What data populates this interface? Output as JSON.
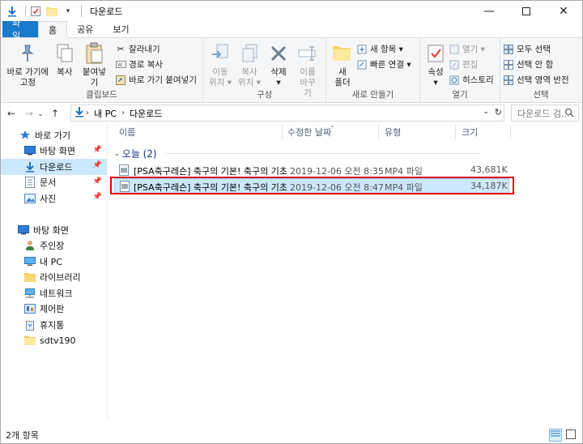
{
  "window": {
    "title": "다운로드",
    "min_icon": "minimize-icon",
    "max_icon": "maximize-icon",
    "close_icon": "close-icon"
  },
  "quick_access": {
    "down_arrow": "down-arrow-icon",
    "properties": "properties-icon",
    "new_folder": "folder-icon",
    "customize": "▾"
  },
  "tabs": [
    {
      "label": "파일"
    },
    {
      "label": "홈"
    },
    {
      "label": "공유"
    },
    {
      "label": "보기"
    }
  ],
  "ribbon": {
    "clipboard": {
      "label": "클립보드",
      "pin": "바로 가기에\n고정",
      "copy": "복사",
      "paste": "붙여넣기",
      "cut": "잘라내기",
      "copy_path": "경로 복사",
      "paste_shortcut": "바로 가기 붙여넣기"
    },
    "organize": {
      "label": "구성",
      "move": "이동\n위치 ▾",
      "copyto": "복사\n위치 ▾",
      "delete": "삭제\n▾",
      "rename": "이름\n바꾸기"
    },
    "new": {
      "label": "새로 만들기",
      "new_folder": "새\n폴더",
      "new_item": "새 항목 ▾",
      "easy_access": "빠른 연결 ▾"
    },
    "open": {
      "label": "열기",
      "properties": "속성\n▾",
      "open": "열기 ▾",
      "edit": "편집",
      "history": "히스토리"
    },
    "select": {
      "label": "선택",
      "select_all": "모두 선택",
      "select_none": "선택 안 함",
      "invert": "선택 영역 반전"
    }
  },
  "address": {
    "crumbs": [
      "내 PC",
      "다운로드"
    ],
    "search_placeholder": "다운로드 검..."
  },
  "navpane": {
    "items": [
      {
        "label": "바로 가기",
        "icon": "star-icon"
      },
      {
        "label": "바탕 화면",
        "icon": "desktop-icon",
        "pinned": true
      },
      {
        "label": "다운로드",
        "icon": "download-icon",
        "pinned": true,
        "selected": true
      },
      {
        "label": "문서",
        "icon": "document-icon",
        "pinned": true
      },
      {
        "label": "사진",
        "icon": "pictures-icon",
        "pinned": true
      },
      {
        "label": "",
        "icon": ""
      },
      {
        "label": "바탕 화면",
        "icon": "desktop-icon"
      },
      {
        "label": "주인장",
        "icon": "user-icon"
      },
      {
        "label": "내 PC",
        "icon": "computer-icon"
      },
      {
        "label": "라이브러리",
        "icon": "library-icon"
      },
      {
        "label": "네트워크",
        "icon": "network-icon"
      },
      {
        "label": "제어판",
        "icon": "control-panel-icon"
      },
      {
        "label": "휴지통",
        "icon": "recycle-bin-icon"
      },
      {
        "label": "sdtv190",
        "icon": "folder-icon"
      }
    ]
  },
  "columns": {
    "name": "이름",
    "modified": "수정한 날짜",
    "type": "유형",
    "size": "크기"
  },
  "group": {
    "label": "오늘 (2)"
  },
  "files": [
    {
      "name": "[PSA축구레슨] 축구의 기본! 축구의 기초...",
      "modified": "2019-12-06 오전 8:35",
      "type": "MP4 파일",
      "size": "43,681KB"
    },
    {
      "name": "[PSA축구레슨] 축구의 기본! 축구의 기초...",
      "modified": "2019-12-06 오전 8:47",
      "type": "MP4 파일",
      "size": "34,187KB"
    }
  ],
  "status": {
    "count": "2개 항목"
  },
  "colors": {
    "accent": "#1979ca",
    "selection": "#cce8ff",
    "highlight_box": "#e10000"
  }
}
